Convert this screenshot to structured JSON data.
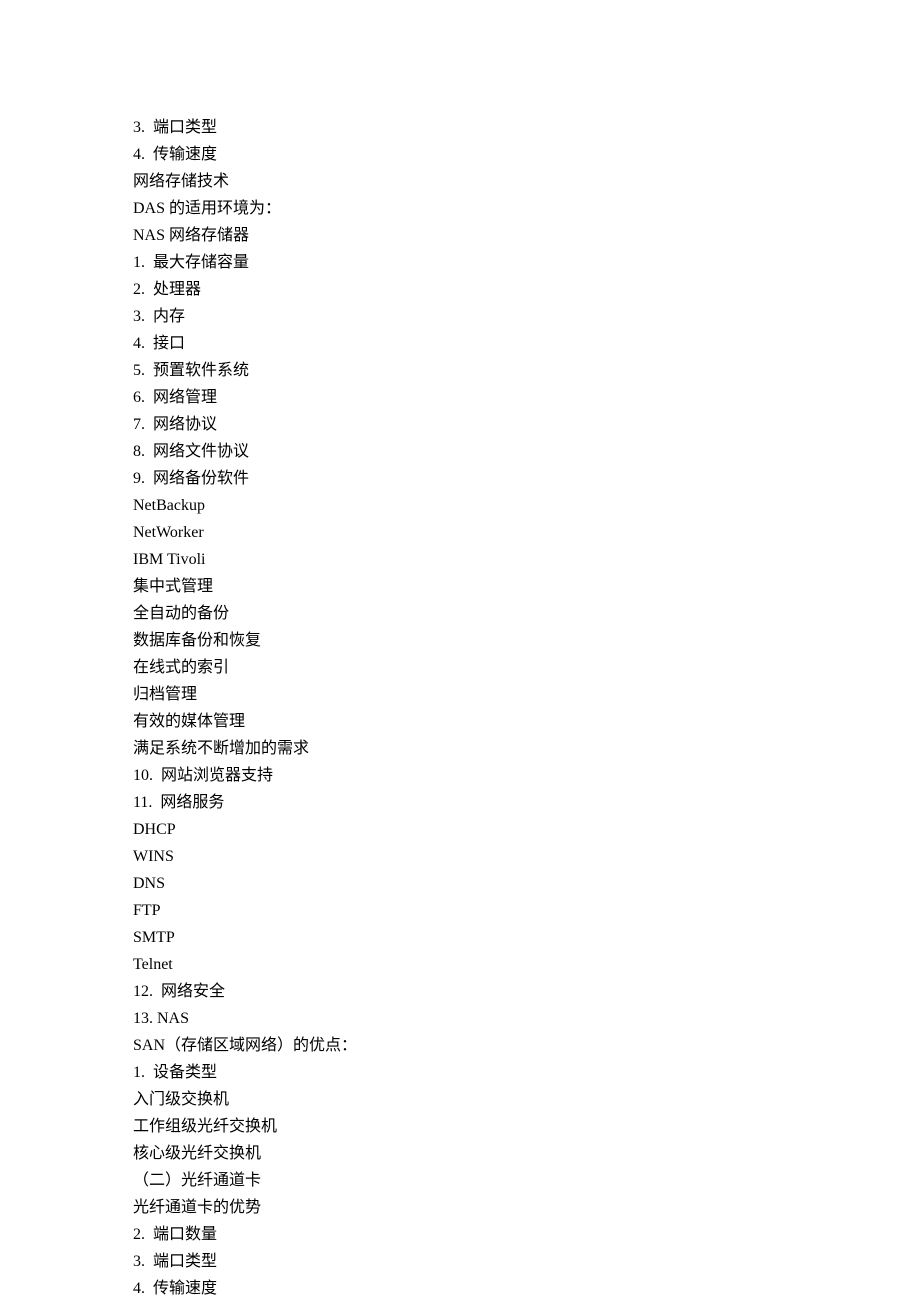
{
  "lines": [
    "3.  端口类型",
    "4.  传输速度",
    "网络存储技术",
    "DAS 的适用环境为：",
    "NAS 网络存储器",
    "1.  最大存储容量",
    "2.  处理器",
    "3.  内存",
    "4.  接口",
    "5.  预置软件系统",
    "6.  网络管理",
    "7.  网络协议",
    "8.  网络文件协议",
    "9.  网络备份软件",
    "NetBackup",
    "NetWorker",
    "IBM Tivoli",
    "集中式管理",
    "全自动的备份",
    "数据库备份和恢复",
    "在线式的索引",
    "归档管理",
    "有效的媒体管理",
    "满足系统不断增加的需求",
    "10.  网站浏览器支持",
    "11.  网络服务",
    "DHCP",
    "WINS",
    "DNS",
    "FTP",
    "SMTP",
    "Telnet",
    "12.  网络安全",
    "13. NAS",
    "SAN（存储区域网络）的优点：",
    "1.  设备类型",
    "入门级交换机",
    "工作组级光纤交换机",
    "核心级光纤交换机",
    "（二）光纤通道卡",
    "光纤通道卡的优势",
    "2.  端口数量",
    "3.  端口类型",
    "4.  传输速度"
  ]
}
